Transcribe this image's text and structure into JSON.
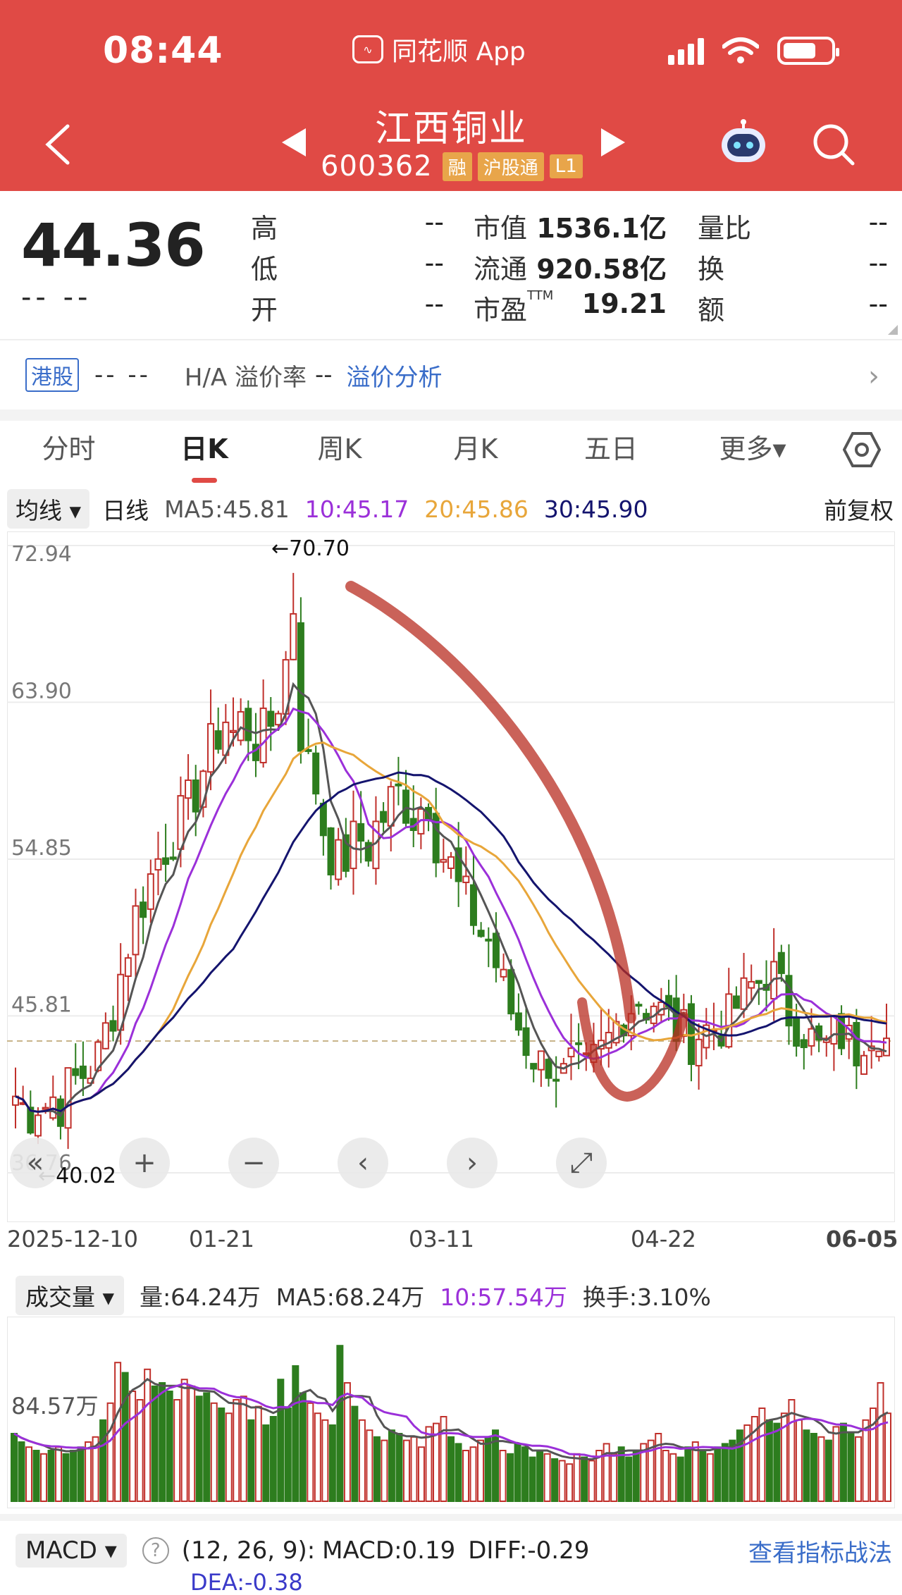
{
  "status_bar": {
    "time": "08:44",
    "app_label": "同花顺 App"
  },
  "header": {
    "stock_name": "江西铜业",
    "stock_code": "600362",
    "tags": [
      "融",
      "沪股通",
      "L1"
    ]
  },
  "quote": {
    "last_price": "44.36",
    "change": "-- --",
    "high_label": "高",
    "high_value": "--",
    "low_label": "低",
    "low_value": "--",
    "open_label": "开",
    "open_value": "--",
    "mktcap_label": "市值",
    "mktcap_value": "1536.1亿",
    "float_label": "流通",
    "float_value": "920.58亿",
    "pe_label": "市盈",
    "pe_sup": "TTM",
    "pe_value": "19.21",
    "vol_ratio_label": "量比",
    "vol_ratio_value": "--",
    "turnover_label": "换",
    "turnover_value": "--",
    "amount_label": "额",
    "amount_value": "--"
  },
  "hk_row": {
    "tag": "港股",
    "value": "-- --",
    "premium_label": "H/A 溢价率",
    "premium_value": "--",
    "link": "溢价分析"
  },
  "tabs": [
    "分时",
    "日K",
    "周K",
    "月K",
    "五日",
    "更多▾"
  ],
  "active_tab": 1,
  "ma_row": {
    "selector": "均线 ▾",
    "period": "日线",
    "ma5": "MA5:45.81",
    "ma10": "10:45.17",
    "ma20": "20:45.86",
    "ma30": "30:45.90",
    "adjust": "前复权"
  },
  "colors": {
    "header_red": "#e04a45",
    "up": "#c0302b",
    "down": "#2d7d1e",
    "ma5": "#555555",
    "ma10": "#9b30d9",
    "ma20": "#e8a63a",
    "ma30": "#14146e",
    "link": "#3a6dc9"
  },
  "chart_data": {
    "type": "candlestick",
    "y_ticks": [
      "72.94",
      "63.90",
      "54.85",
      "45.81",
      "36.76"
    ],
    "ylim": [
      36.76,
      72.94
    ],
    "x_labels": [
      "2025-12-10",
      "01-21",
      "03-11",
      "04-22",
      "06-05"
    ],
    "max_label": "←70.70",
    "min_label": "←40.02",
    "reference_price": 44.36,
    "controls": [
      "«",
      "+",
      "−",
      "‹",
      "›",
      "⤢"
    ],
    "ma5_close": [
      41.2,
      40.6,
      40.3,
      40.9,
      40.7,
      41.1,
      40.8,
      41.6,
      42.1,
      42.5,
      42.9,
      43.4,
      44.9,
      46.3,
      48.2,
      50.0,
      51.6,
      52.6,
      53.8,
      54.9,
      55.6,
      56.3,
      57.1,
      57.9,
      58.8,
      60.1,
      61.2,
      62.2,
      63.0,
      62.1,
      62.8,
      62.4,
      61.6,
      62.0,
      62.7,
      64.1,
      66.2,
      64.7,
      62.2,
      60.2,
      59.1,
      56.7,
      55.3,
      54.6,
      55.0,
      55.8,
      56.0,
      55.6,
      56.7,
      57.3,
      58.2,
      58.6,
      58.1,
      57.4,
      57.9,
      58.4,
      56.1,
      55.1,
      54.4,
      53.1,
      52.4,
      51.6,
      50.6,
      50.2,
      48.8,
      47.4,
      46.1,
      45.2,
      44.3,
      43.6,
      43.0,
      43.4,
      42.8,
      42.2,
      42.8,
      42.7,
      42.3,
      43.0,
      43.6,
      44.4,
      45.3,
      46.2,
      46.5,
      46.9,
      46.5,
      46.7,
      46.0,
      45.6,
      45.1,
      44.7,
      44.6,
      44.9,
      45.0,
      45.2,
      45.4,
      45.5,
      46.4,
      46.8,
      47.5,
      47.8,
      48.5,
      48.0,
      47.0,
      46.0,
      45.6,
      45.1,
      44.4,
      43.8,
      44.0,
      44.6,
      44.8,
      44.2,
      44.0,
      45.0,
      45.4,
      45.3,
      44.4
    ]
  },
  "dates_row": [
    "2025-12-10",
    "01-21",
    "03-11",
    "04-22",
    "06-05"
  ],
  "volume": {
    "selector": "成交量 ▾",
    "vol": "量:64.24万",
    "ma5": "MA5:68.24万",
    "ma10": "10:57.54万",
    "turnover": "换手:3.10%",
    "y_tick": "84.57万",
    "bars": [
      40,
      35,
      32,
      30,
      28,
      30,
      32,
      28,
      30,
      32,
      35,
      38,
      48,
      58,
      82,
      76,
      65,
      60,
      78,
      68,
      70,
      65,
      60,
      72,
      68,
      62,
      64,
      58,
      55,
      52,
      60,
      62,
      48,
      56,
      45,
      50,
      72,
      55,
      80,
      64,
      58,
      52,
      48,
      45,
      92,
      70,
      56,
      48,
      42,
      38,
      36,
      42,
      40,
      36,
      38,
      32,
      44,
      46,
      50,
      38,
      34,
      30,
      32,
      36,
      38,
      42,
      30,
      28,
      34,
      32,
      26,
      30,
      28,
      25,
      24,
      22,
      28,
      26,
      24,
      30,
      34,
      28,
      32,
      26,
      30,
      34,
      36,
      40,
      30,
      28,
      26,
      32,
      35,
      30,
      28,
      32,
      34,
      36,
      42,
      45,
      50,
      55,
      48,
      46,
      52,
      60,
      48,
      42,
      40,
      38,
      36,
      44,
      46,
      40,
      38,
      48,
      55,
      70,
      52
    ]
  },
  "macd": {
    "selector": "MACD ▾",
    "help": "?",
    "params": "(12, 26, 9):",
    "macd": "MACD:0.19",
    "diff": "DIFF:-0.29",
    "dea": "DEA:-0.38",
    "link": "查看指标战法"
  }
}
